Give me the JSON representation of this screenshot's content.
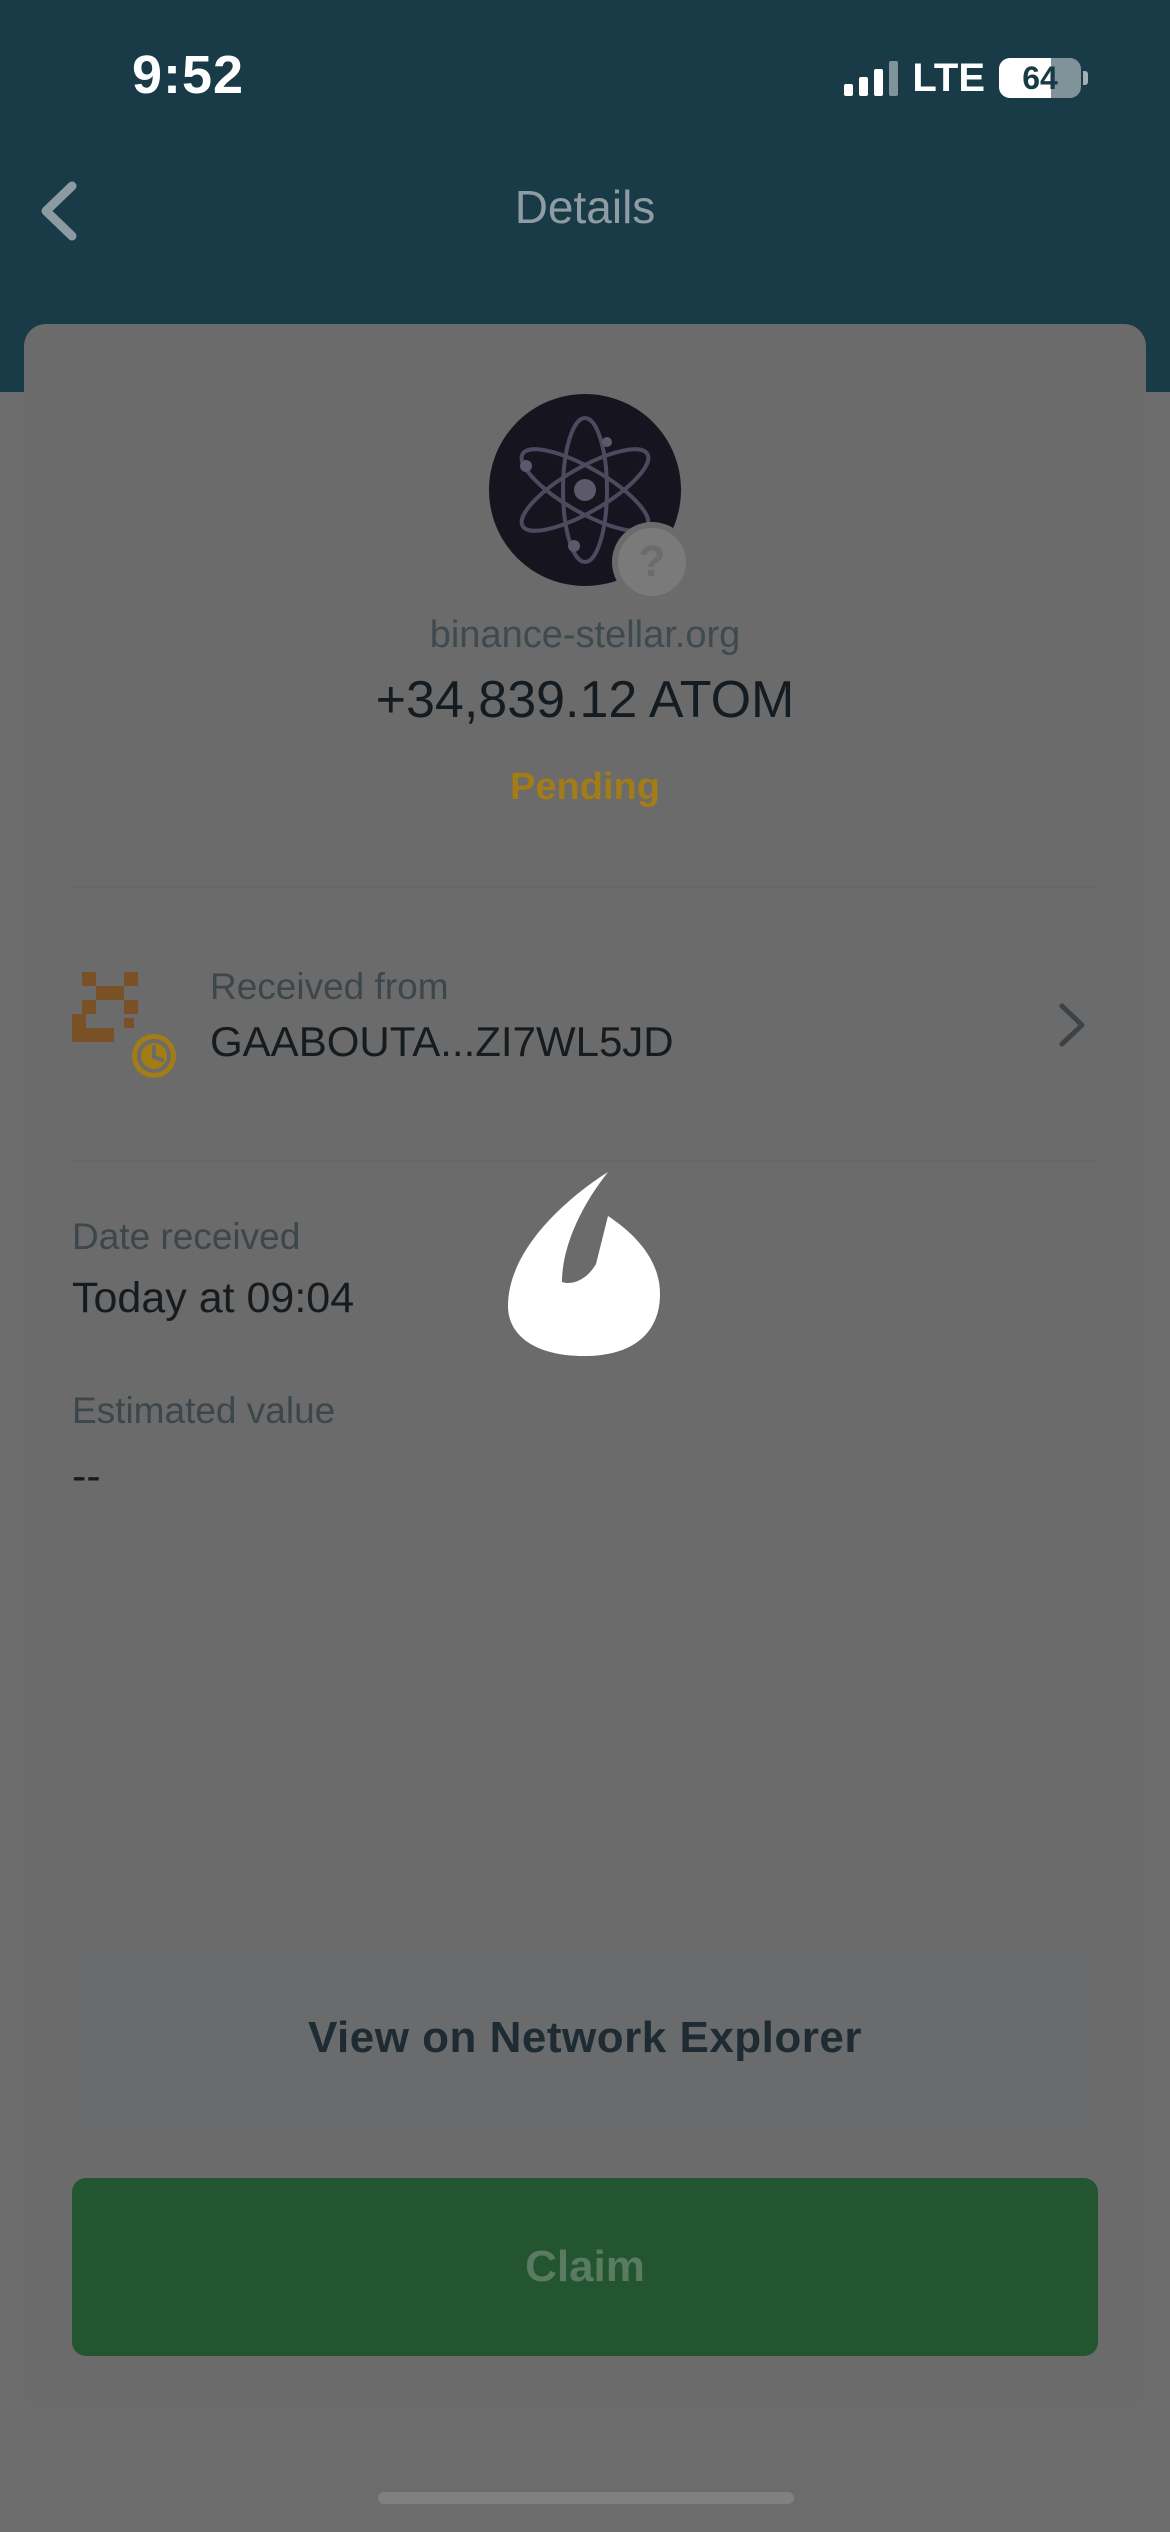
{
  "status_bar": {
    "time": "9:52",
    "network": "LTE",
    "battery": "64"
  },
  "header": {
    "title": "Details"
  },
  "transaction": {
    "token_name": "binance-stellar.org",
    "amount": "+34,839.12 ATOM",
    "status": "Pending",
    "badge": "?"
  },
  "sender": {
    "label": "Received from",
    "address": "GAABOUTA...ZI7WL5JD"
  },
  "details": {
    "date_label": "Date received",
    "date_value": "Today at 09:04",
    "value_label": "Estimated value",
    "value_value": "--"
  },
  "actions": {
    "explorer_label": "View on Network Explorer",
    "claim_label": "Claim"
  },
  "colors": {
    "header": "#193a47",
    "pending": "#a37b17",
    "claim": "#235531"
  },
  "icons": {
    "back": "chevron-left-icon",
    "token": "cosmos-atom-icon",
    "badge": "question-mark-icon",
    "sender": "identicon-icon",
    "clock": "clock-icon",
    "row_chevron": "chevron-right-icon",
    "loader": "flame-icon"
  }
}
